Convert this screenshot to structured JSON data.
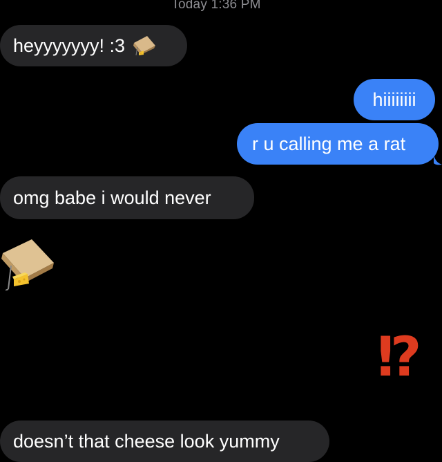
{
  "conversation": {
    "timestamp": "Today 1:36 PM",
    "messages": [
      {
        "from": "them",
        "text": "heyyyyyyy! :3",
        "emoji": "mousetrap-with-cheese"
      },
      {
        "from": "me",
        "text": "hiiiiiiii"
      },
      {
        "from": "me",
        "text": "r u calling me a rat"
      },
      {
        "from": "them",
        "text": "omg babe i would never"
      },
      {
        "from": "them",
        "emoji": "mousetrap-with-cheese"
      },
      {
        "from": "me",
        "emoji": "exclamation-question-mark",
        "text": "⁉"
      },
      {
        "from": "them",
        "text": "doesn’t that cheese look yummy"
      }
    ]
  },
  "colors": {
    "background": "#000000",
    "incoming_bubble": "#262628",
    "outgoing_bubble": "#3a82f7",
    "timestamp": "#8e8e93",
    "interrobang": "#de3b1f"
  }
}
